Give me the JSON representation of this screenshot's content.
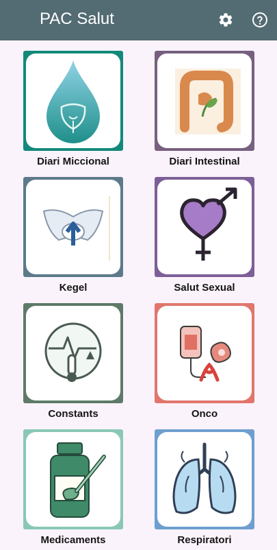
{
  "app_bar": {
    "title": "PAC Salut",
    "settings_icon": "gear-icon",
    "help_icon": "help-circle-icon",
    "background": "#536b73"
  },
  "modules": [
    {
      "label": "Diari Miccional",
      "icon": "water-drop-bladder-icon",
      "frame_color": "#12897a"
    },
    {
      "label": "Diari Intestinal",
      "icon": "intestine-icon",
      "frame_color": "#77607f"
    },
    {
      "label": "Kegel",
      "icon": "pelvis-arrow-icon",
      "frame_color": "#5c7a8a"
    },
    {
      "label": "Salut Sexual",
      "icon": "gender-heart-icon",
      "frame_color": "#7d5f97"
    },
    {
      "label": "Constants",
      "icon": "vital-signs-icon",
      "frame_color": "#5e7a68"
    },
    {
      "label": "Onco",
      "icon": "cancer-ribbon-icon",
      "frame_color": "#e0766c"
    },
    {
      "label": "Medicaments",
      "icon": "medicine-bottle-icon",
      "frame_color": "#8ac8b6"
    },
    {
      "label": "Respiratori",
      "icon": "lungs-icon",
      "frame_color": "#6e9fcf"
    }
  ]
}
